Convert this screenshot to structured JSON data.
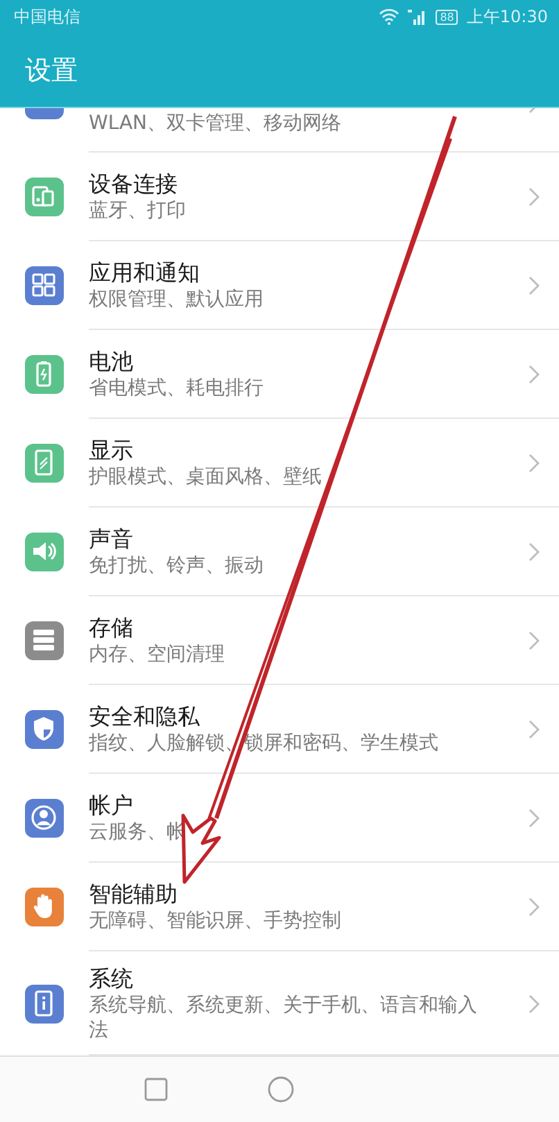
{
  "status_bar": {
    "carrier": "中国电信",
    "battery": "88",
    "time": "上午10:30"
  },
  "header": {
    "title": "设置"
  },
  "items": [
    {
      "kind": "network",
      "color": "#5b7fd0",
      "subtitle": "WLAN、双卡管理、移动网络"
    },
    {
      "kind": "devices",
      "color": "#5cc28c",
      "title": "设备连接",
      "subtitle": "蓝牙、打印"
    },
    {
      "kind": "apps",
      "color": "#5b7fd0",
      "title": "应用和通知",
      "subtitle": "权限管理、默认应用"
    },
    {
      "kind": "battery",
      "color": "#5cc28c",
      "title": "电池",
      "subtitle": "省电模式、耗电排行"
    },
    {
      "kind": "display",
      "color": "#5cc28c",
      "title": "显示",
      "subtitle": "护眼模式、桌面风格、壁纸"
    },
    {
      "kind": "sound",
      "color": "#5cc28c",
      "title": "声音",
      "subtitle": "免打扰、铃声、振动"
    },
    {
      "kind": "storage",
      "color": "#8c8c8c",
      "title": "存储",
      "subtitle": "内存、空间清理"
    },
    {
      "kind": "security",
      "color": "#5b7fd0",
      "title": "安全和隐私",
      "subtitle": "指纹、人脸解锁、锁屏和密码、学生模式"
    },
    {
      "kind": "account",
      "color": "#5b7fd0",
      "title": "帐户",
      "subtitle": "云服务、帐"
    },
    {
      "kind": "assist",
      "color": "#e8813a",
      "title": "智能辅助",
      "subtitle": "无障碍、智能识屏、手势控制"
    },
    {
      "kind": "system",
      "color": "#5b7fd0",
      "title": "系统",
      "subtitle": "系统导航、系统更新、关于手机、语言和输入法"
    }
  ],
  "annotation": {
    "kind": "arrow"
  }
}
